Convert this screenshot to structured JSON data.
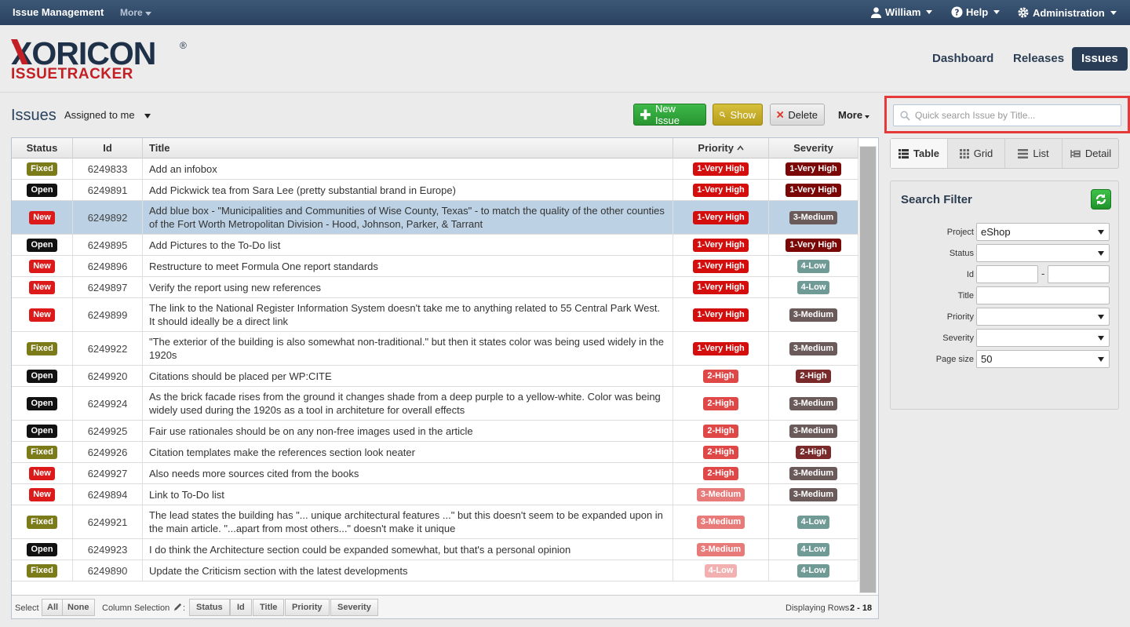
{
  "topbar": {
    "brand": "Issue Management",
    "more": "More",
    "user": "William",
    "help": "Help",
    "admin": "Administration"
  },
  "logo": {
    "line1": "XORICON",
    "line2": "ISSUETRACKER",
    "reg": "®"
  },
  "nav": {
    "dashboard": "Dashboard",
    "releases": "Releases",
    "issues": "Issues"
  },
  "toolbar": {
    "title": "Issues",
    "assigned": "Assigned to me",
    "new_issue": "New Issue",
    "show": "Show",
    "delete": "Delete",
    "more": "More"
  },
  "search": {
    "placeholder": "Quick search Issue by Title..."
  },
  "table": {
    "columns": {
      "status": "Status",
      "id": "Id",
      "title": "Title",
      "priority": "Priority",
      "severity": "Severity"
    },
    "rows": [
      {
        "status": "Fixed",
        "id": "6249833",
        "title": "Add an infobox",
        "priority": "1-Very High",
        "severity": "1-Very High"
      },
      {
        "status": "Open",
        "id": "6249891",
        "title": "Add Pickwick tea from Sara Lee (pretty substantial brand in Europe)",
        "priority": "1-Very High",
        "severity": "1-Very High"
      },
      {
        "status": "New",
        "id": "6249892",
        "title": "Add blue box - \"Municipalities and Communities of Wise County, Texas\" - to match the quality of the other counties of the Fort Worth Metropolitan Division - Hood, Johnson, Parker, & Tarrant",
        "priority": "1-Very High",
        "severity": "3-Medium"
      },
      {
        "status": "Open",
        "id": "6249895",
        "title": "Add Pictures to the To-Do list",
        "priority": "1-Very High",
        "severity": "1-Very High"
      },
      {
        "status": "New",
        "id": "6249896",
        "title": "Restructure to meet Formula One report standards",
        "priority": "1-Very High",
        "severity": "4-Low"
      },
      {
        "status": "New",
        "id": "6249897",
        "title": "Verify the report using new references",
        "priority": "1-Very High",
        "severity": "4-Low"
      },
      {
        "status": "New",
        "id": "6249899",
        "title": "The link to the National Register Information System doesn't take me to anything related to 55 Central Park West. It should ideally be a direct link",
        "priority": "1-Very High",
        "severity": "3-Medium"
      },
      {
        "status": "Fixed",
        "id": "6249922",
        "title": "\"The exterior of the building is also somewhat non-traditional.\" but then it states color was being used widely in the 1920s",
        "priority": "1-Very High",
        "severity": "3-Medium"
      },
      {
        "status": "Open",
        "id": "6249920",
        "title": "Citations should be placed per WP:CITE",
        "priority": "2-High",
        "severity": "2-High"
      },
      {
        "status": "Open",
        "id": "6249924",
        "title": "As the brick facade rises from the ground it changes shade from a deep purple to a yellow-white. Color was being widely used during the 1920s as a tool in architeture for overall effects",
        "priority": "2-High",
        "severity": "3-Medium"
      },
      {
        "status": "Open",
        "id": "6249925",
        "title": "Fair use rationales should be on any non-free images used in the article",
        "priority": "2-High",
        "severity": "3-Medium"
      },
      {
        "status": "Fixed",
        "id": "6249926",
        "title": "Citation templates make the references section look neater",
        "priority": "2-High",
        "severity": "2-High"
      },
      {
        "status": "New",
        "id": "6249927",
        "title": "Also needs more sources cited from the books",
        "priority": "2-High",
        "severity": "3-Medium"
      },
      {
        "status": "New",
        "id": "6249894",
        "title": "Link to To-Do list",
        "priority": "3-Medium",
        "severity": "3-Medium"
      },
      {
        "status": "Fixed",
        "id": "6249921",
        "title": "The lead states the building has \"... unique architectural features ...\" but this doesn't seem to be expanded upon in the main article. \"...apart from most others...\" doesn't make it unique",
        "priority": "3-Medium",
        "severity": "4-Low"
      },
      {
        "status": "Open",
        "id": "6249923",
        "title": "I do think the Architecture section could be expanded somewhat, but that's a personal opinion",
        "priority": "3-Medium",
        "severity": "4-Low"
      },
      {
        "status": "Fixed",
        "id": "6249890",
        "title": "Update the Criticism section with the latest developments",
        "priority": "4-Low",
        "severity": "4-Low"
      }
    ]
  },
  "footer": {
    "select": "Select",
    "all": "All",
    "none": "None",
    "column_selection": "Column Selection",
    "colon": ":",
    "col_status": "Status",
    "col_id": "Id",
    "col_title": "Title",
    "col_priority": "Priority",
    "col_severity": "Severity",
    "displaying": "Displaying Rows",
    "range": "2 - 18"
  },
  "views": {
    "table": "Table",
    "grid": "Grid",
    "list": "List",
    "detail": "Detail"
  },
  "filter": {
    "title": "Search Filter",
    "project_label": "Project",
    "project_value": "eShop",
    "status_label": "Status",
    "status_value": "",
    "id_label": "Id",
    "id_sep": "-",
    "title_label": "Title",
    "priority_label": "Priority",
    "severity_label": "Severity",
    "pagesize_label": "Page size",
    "pagesize_value": "50"
  },
  "colors": {
    "priority": {
      "1-Very High": "#d40d0d",
      "2-High": "#e04848",
      "3-Medium": "#e97a7a",
      "4-Low": "#f2b0b0"
    },
    "severity": {
      "1-Very High": "#7a0606",
      "2-High": "#7a2a2a",
      "3-Medium": "#6b5a5a",
      "4-Low": "#6f9a96"
    }
  }
}
